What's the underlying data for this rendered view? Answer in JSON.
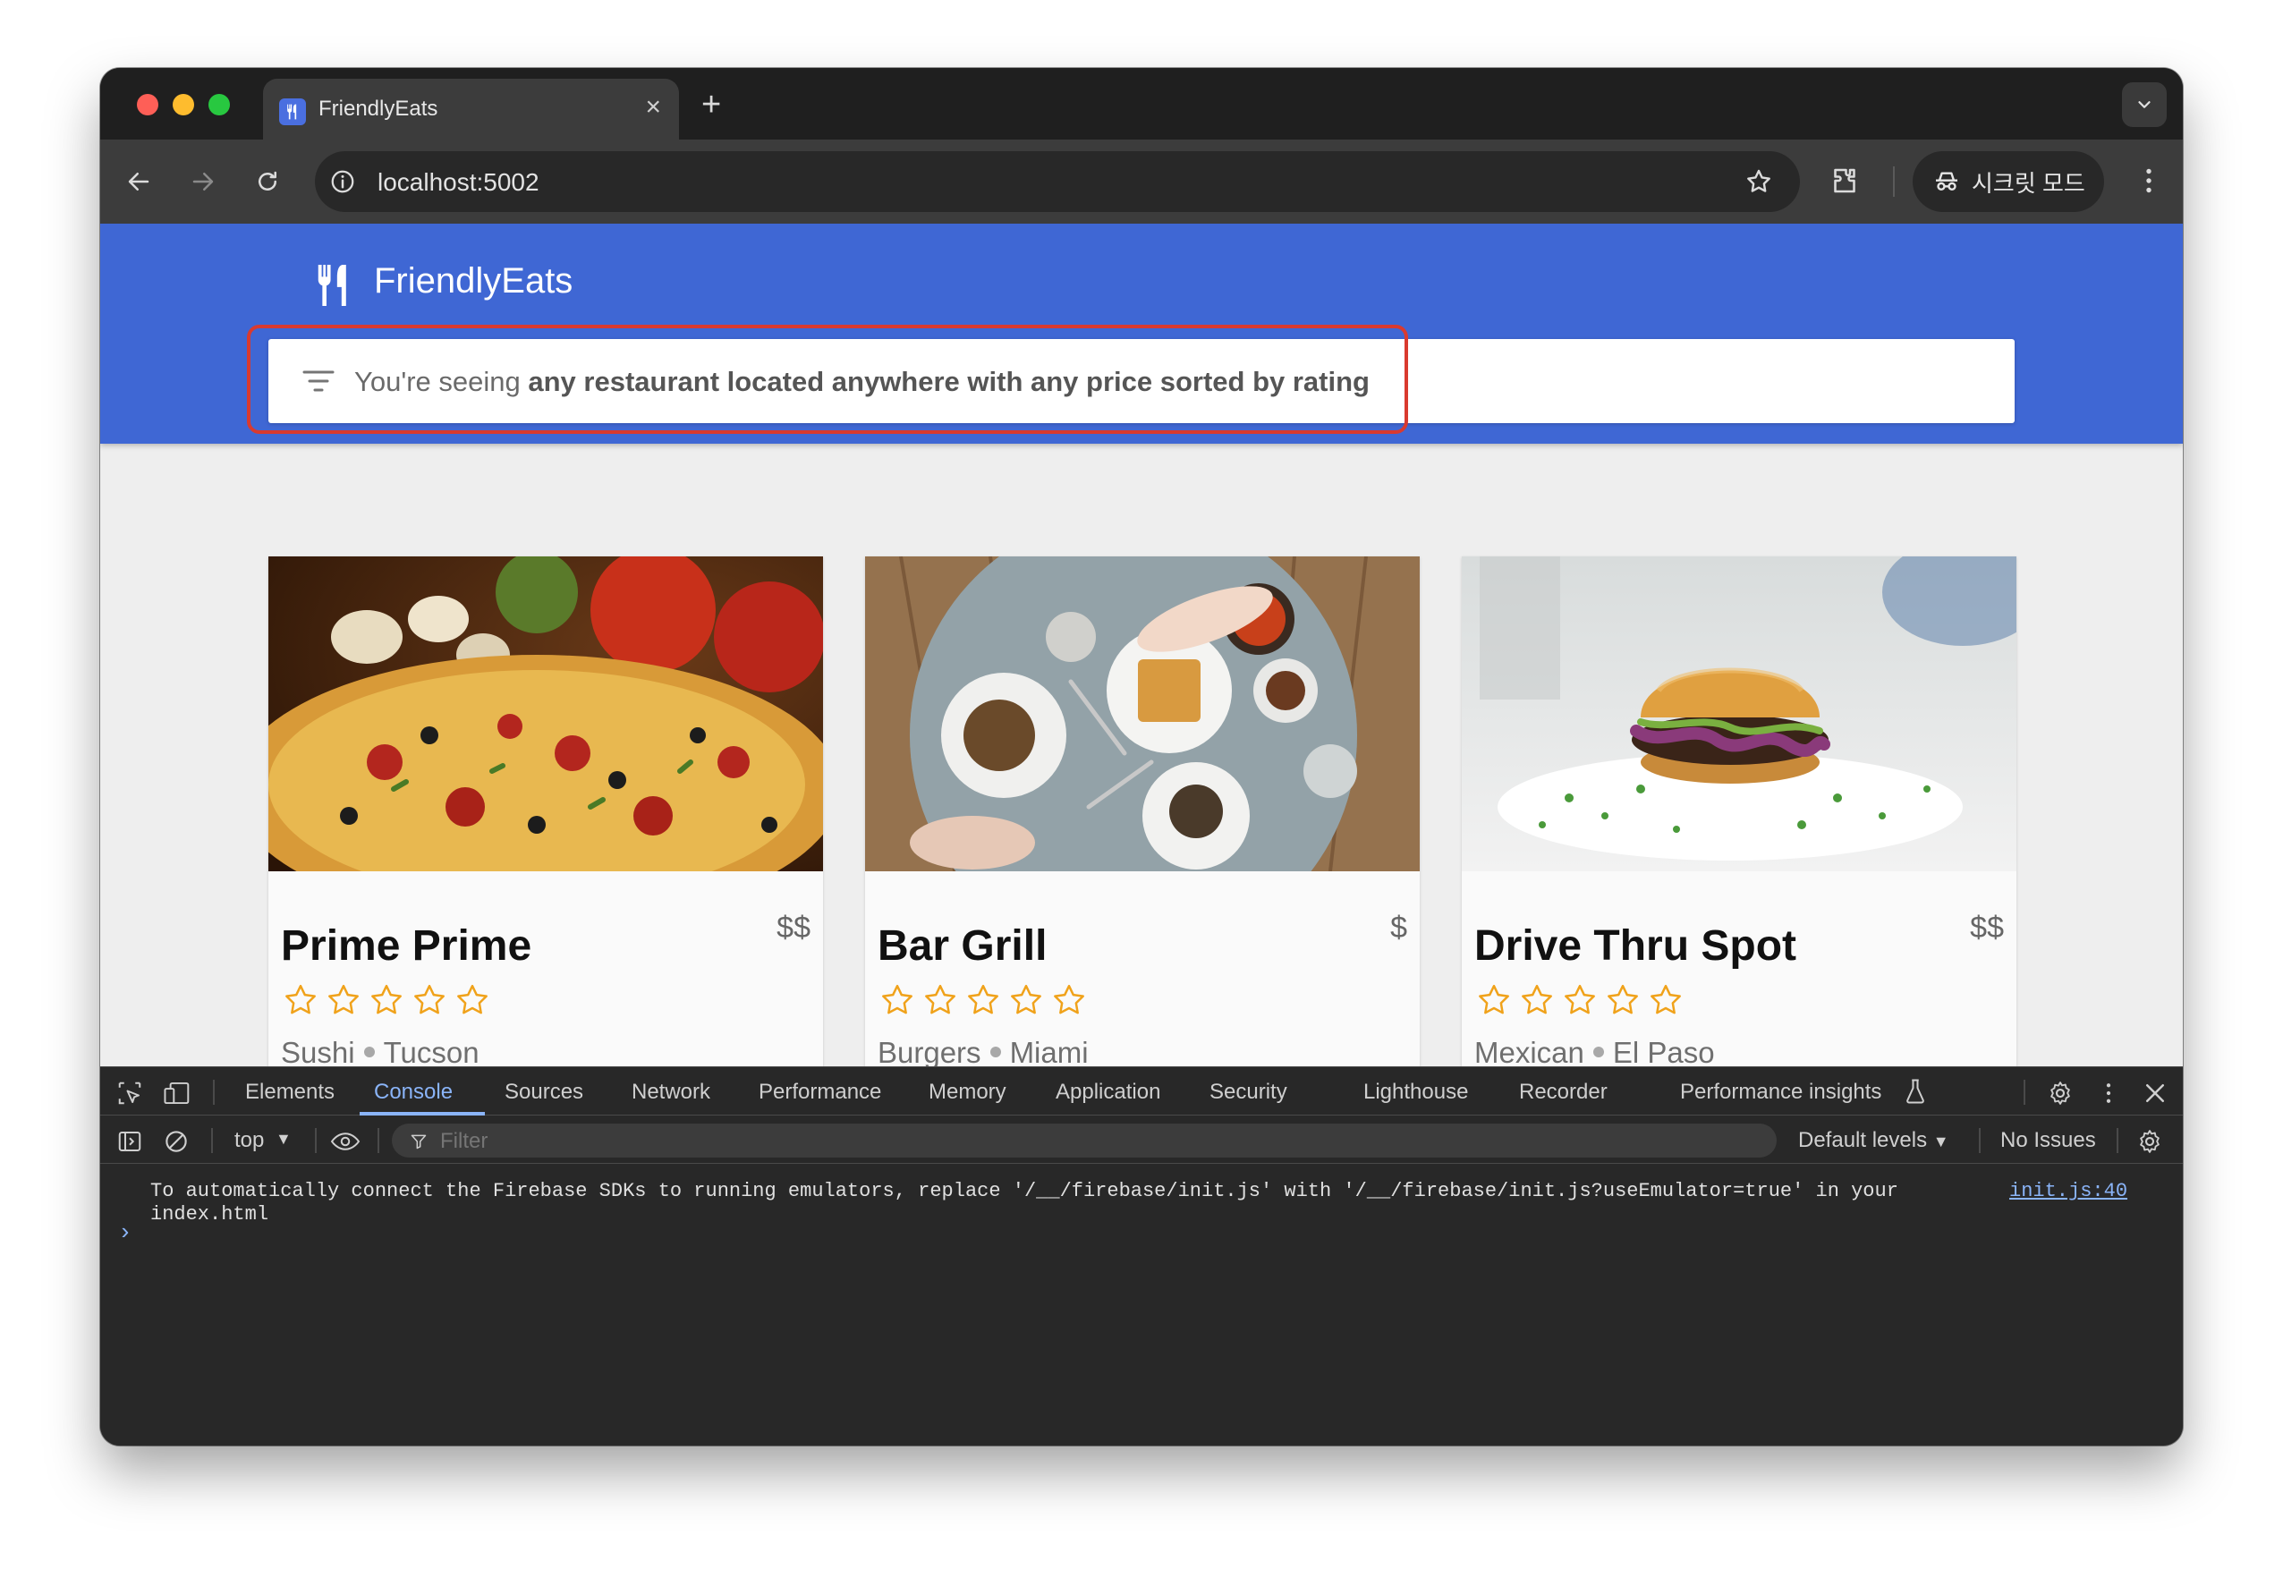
{
  "browser": {
    "tab_title": "FriendlyEats",
    "new_tab": "+",
    "close_glyph": "×",
    "url": "localhost:5002",
    "incognito_label": "시크릿 모드",
    "icons": [
      "back-icon",
      "forward-icon",
      "reload-icon",
      "info-icon",
      "star-icon",
      "extensions-icon",
      "incognito-icon",
      "kebab-icon"
    ]
  },
  "app": {
    "title": "FriendlyEats",
    "brand_color": "#3f67d4",
    "filter": {
      "prefix": "You're seeing ",
      "emphasis": "any restaurant located anywhere with any price sorted by rating"
    },
    "highlight_color": "#d93a2f"
  },
  "restaurants": [
    {
      "name": "Prime Prime",
      "price": "$$",
      "rating": 0,
      "category": "Sushi",
      "city": "Tucson",
      "image": "pizza"
    },
    {
      "name": "Bar Grill",
      "price": "$",
      "rating": 0,
      "category": "Burgers",
      "city": "Miami",
      "image": "brunch-table"
    },
    {
      "name": "Drive Thru Spot",
      "price": "$$",
      "rating": 0,
      "category": "Mexican",
      "city": "El Paso",
      "image": "burger"
    }
  ],
  "devtools": {
    "tabs": [
      "Elements",
      "Console",
      "Sources",
      "Network",
      "Performance",
      "Memory",
      "Application",
      "Security",
      "Lighthouse",
      "Recorder",
      "Performance insights"
    ],
    "active_tab": "Console",
    "context": "top",
    "filter_placeholder": "Filter",
    "levels": "Default levels",
    "issues": "No Issues",
    "message": "To automatically connect the Firebase SDKs to running emulators, replace '/__/firebase/init.js' with '/__/firebase/init.js?useEmulator=true' in your index.html",
    "message_source": "init.js:40",
    "prompt": "›"
  }
}
